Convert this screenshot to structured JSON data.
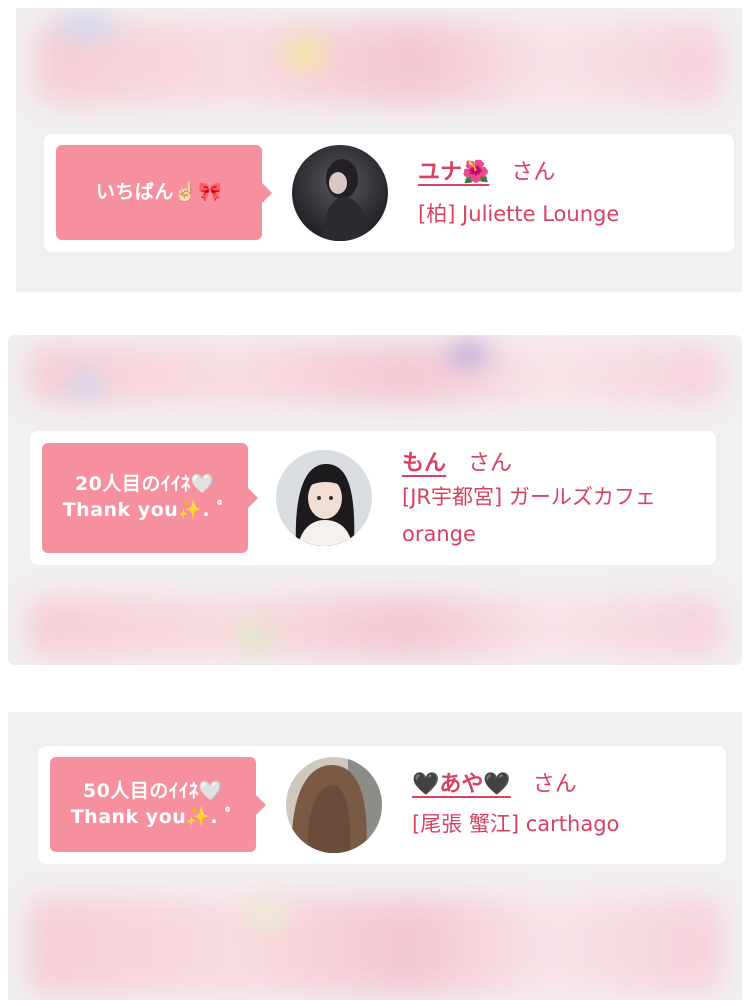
{
  "colors": {
    "accent": "#d8415f",
    "bubble": "#f7909e",
    "panel_bg": "#f1eff0",
    "card_bg": "#ffffff"
  },
  "entries": [
    {
      "bubble_line1": "いちばん☝🏻🎀",
      "bubble_line2": "",
      "name": "ユナ🌺",
      "honorific": "さん",
      "shop": "[柏] Juliette Lounge",
      "avatar_icon": "profile-photo-dark"
    },
    {
      "bubble_line1": "20人目のｲｲﾈ🤍",
      "bubble_line2": "Thank you✨. ﾟ",
      "name": "もん",
      "honorific": "さん",
      "shop": "[JR宇都宮] ガールズカフェorange",
      "avatar_icon": "profile-photo-light"
    },
    {
      "bubble_line1": "50人目のｲｲﾈ🤍",
      "bubble_line2": "Thank you✨. ﾟ",
      "name": "🖤あや🖤",
      "honorific": "さん",
      "shop": "[尾張 蟹江] carthago",
      "avatar_icon": "profile-photo-hair"
    }
  ]
}
